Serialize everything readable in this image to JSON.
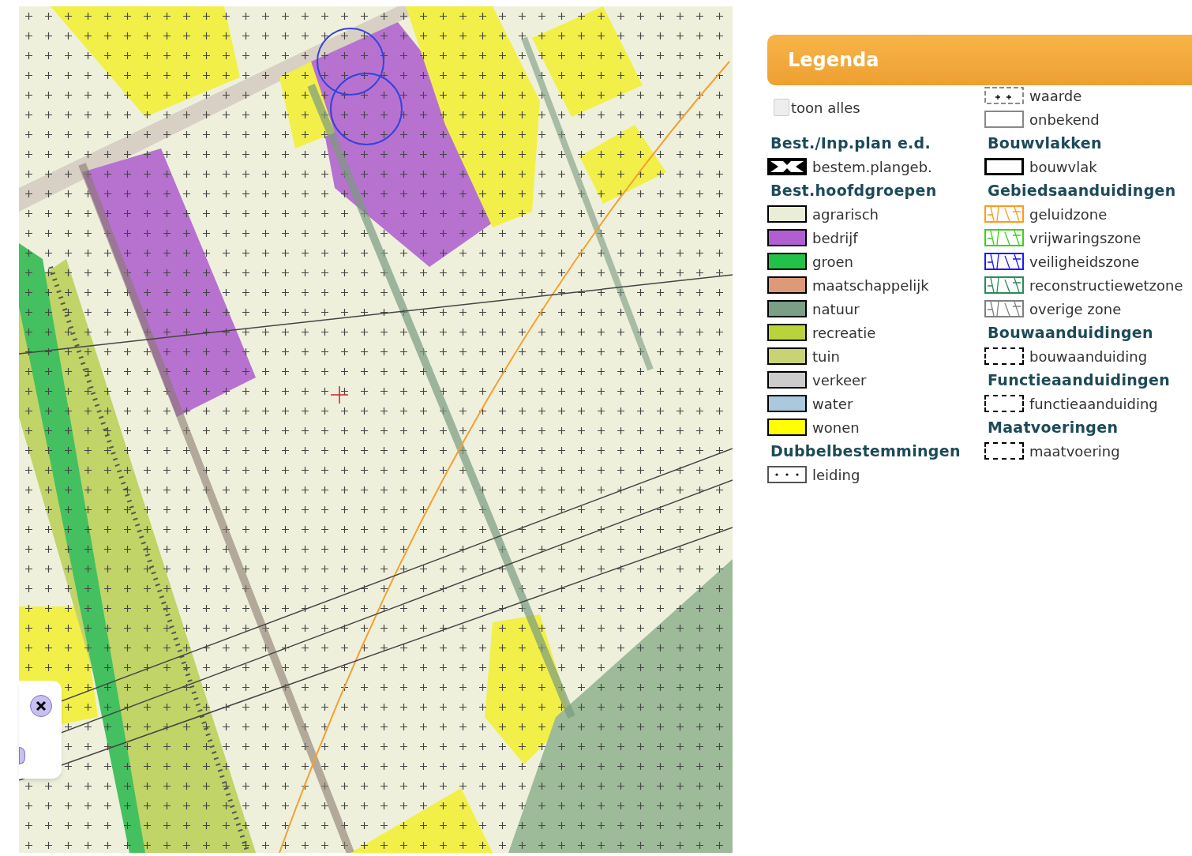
{
  "legend": {
    "title": "Legenda",
    "show_all": {
      "label": "toon alles",
      "checked": false
    },
    "columns": [
      [
        {
          "kind": "heading",
          "label": "Best./Inp.plan e.d."
        },
        {
          "kind": "cross",
          "label": "bestem.plangeb."
        },
        {
          "kind": "heading",
          "label": "Best.hoofdgroepen"
        },
        {
          "kind": "fill",
          "label": "agrarisch",
          "color": "#eaeed6"
        },
        {
          "kind": "fill",
          "label": "bedrijf",
          "color": "#b15ed3"
        },
        {
          "kind": "fill",
          "label": "groen",
          "color": "#22c147"
        },
        {
          "kind": "fill",
          "label": "maatschappelijk",
          "color": "#dc9a78"
        },
        {
          "kind": "fill",
          "label": "natuur",
          "color": "#7a9f86"
        },
        {
          "kind": "fill",
          "label": "recreatie",
          "color": "#b8d43a"
        },
        {
          "kind": "fill",
          "label": "tuin",
          "color": "#c8d474"
        },
        {
          "kind": "fill",
          "label": "verkeer",
          "color": "#cccccc"
        },
        {
          "kind": "fill",
          "label": "water",
          "color": "#acc8dc"
        },
        {
          "kind": "fill",
          "label": "wonen",
          "color": "#ffff00"
        },
        {
          "kind": "heading",
          "label": "Dubbelbestemmingen"
        },
        {
          "kind": "dots",
          "label": "leiding"
        }
      ],
      [
        {
          "kind": "plus",
          "label": "waarde"
        },
        {
          "kind": "empty",
          "label": "onbekend"
        },
        {
          "kind": "heading",
          "label": "Bouwvlakken"
        },
        {
          "kind": "outline",
          "label": "bouwvlak"
        },
        {
          "kind": "heading",
          "label": "Gebiedsaanduidingen"
        },
        {
          "kind": "zone",
          "label": "geluidzone",
          "color": "#ff9a1a"
        },
        {
          "kind": "zone",
          "label": "vrijwaringszone",
          "color": "#3ad21a"
        },
        {
          "kind": "zone",
          "label": "veiligheidszone",
          "color": "#1a1aff"
        },
        {
          "kind": "zone",
          "label": "reconstructiewetzone",
          "color": "#2a8a5a"
        },
        {
          "kind": "zone",
          "label": "overige zone",
          "color": "#808080"
        },
        {
          "kind": "heading",
          "label": "Bouwaanduidingen"
        },
        {
          "kind": "dashed",
          "label": "bouwaanduiding"
        },
        {
          "kind": "heading",
          "label": "Functieaanduidingen"
        },
        {
          "kind": "dashed",
          "label": "functieaanduiding"
        },
        {
          "kind": "heading",
          "label": "Maatvoeringen"
        },
        {
          "kind": "dashed",
          "label": "maatvoering"
        }
      ]
    ]
  }
}
